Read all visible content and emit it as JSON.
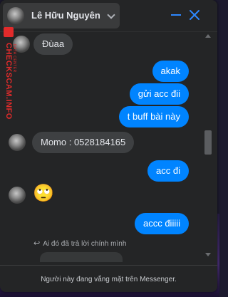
{
  "header": {
    "contact_name": "Lê Hữu Nguyên",
    "icons": [
      "avatar",
      "chevron-down-icon",
      "minimize-icon",
      "close-icon"
    ]
  },
  "messages": [
    {
      "direction": "in",
      "text": "Đùaa",
      "avatar": true
    },
    {
      "direction": "out",
      "text": "akak"
    },
    {
      "direction": "out",
      "text": "gửi acc đii"
    },
    {
      "direction": "out",
      "text": "t buff bài này"
    },
    {
      "direction": "in",
      "text": "Momo : 0528184165",
      "avatar": true
    },
    {
      "direction": "out",
      "text": "acc đi"
    },
    {
      "direction": "in",
      "emoji": "🙄",
      "avatar": true
    },
    {
      "direction": "out",
      "text": "accc điiiii"
    }
  ],
  "reply_hint": "Ai đó đã trả lời chính mình",
  "footer": {
    "status_text": "Người này đang vắng mặt trên Messenger."
  },
  "watermark": {
    "main": "CHECKSCAM.INFO",
    "sub": "DATA CENTER"
  },
  "colors": {
    "outgoing_bubble": "#0084ff",
    "incoming_bubble": "#3e4042",
    "panel_background": "#242526",
    "accent": "#2d88ff",
    "watermark": "#e12b2b"
  }
}
